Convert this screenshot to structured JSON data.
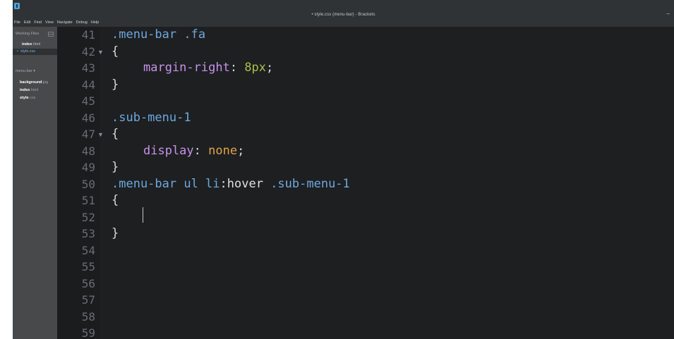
{
  "window": {
    "title": "• style.css (menu-bar) - Brackets",
    "minimize": "–"
  },
  "menubar": {
    "items": [
      "File",
      "Edit",
      "Find",
      "View",
      "Navigate",
      "Debug",
      "Help"
    ]
  },
  "sidebar": {
    "working_files_header": "Working Files",
    "working_files": [
      {
        "name": "index",
        "ext": ".html"
      },
      {
        "dot": "•",
        "name": "style",
        "ext": ".css"
      }
    ],
    "project_header": "menu-bar ▾",
    "tree": [
      {
        "name": "background",
        "ext": ".jpg"
      },
      {
        "name": "index",
        "ext": ".html"
      },
      {
        "name": "style",
        "ext": ".css"
      }
    ]
  },
  "editor": {
    "fold_marker": "▼",
    "cursor_glyph": "I",
    "lines": [
      {
        "n": "41",
        "t": [
          ".menu-bar .fa"
        ]
      },
      {
        "n": "42",
        "t": [
          "{"
        ]
      },
      {
        "n": "43",
        "t": [
          "margin-right",
          ": ",
          "8px",
          ";"
        ]
      },
      {
        "n": "44",
        "t": [
          "}"
        ]
      },
      {
        "n": "45",
        "t": []
      },
      {
        "n": "46",
        "t": [
          ".sub-menu-1"
        ]
      },
      {
        "n": "47",
        "t": [
          "{"
        ]
      },
      {
        "n": "48",
        "t": [
          "display",
          ": ",
          "none",
          ";"
        ]
      },
      {
        "n": "49",
        "t": [
          "}"
        ]
      },
      {
        "n": "50",
        "t": [
          ".menu-bar ul li",
          ":hover",
          " .sub-menu-1"
        ]
      },
      {
        "n": "51",
        "t": [
          "{"
        ]
      },
      {
        "n": "52",
        "t": []
      },
      {
        "n": "53",
        "t": [
          "}"
        ]
      },
      {
        "n": "54",
        "t": []
      },
      {
        "n": "55",
        "t": []
      },
      {
        "n": "56",
        "t": []
      },
      {
        "n": "57",
        "t": []
      },
      {
        "n": "58",
        "t": []
      },
      {
        "n": "59",
        "t": []
      }
    ]
  }
}
